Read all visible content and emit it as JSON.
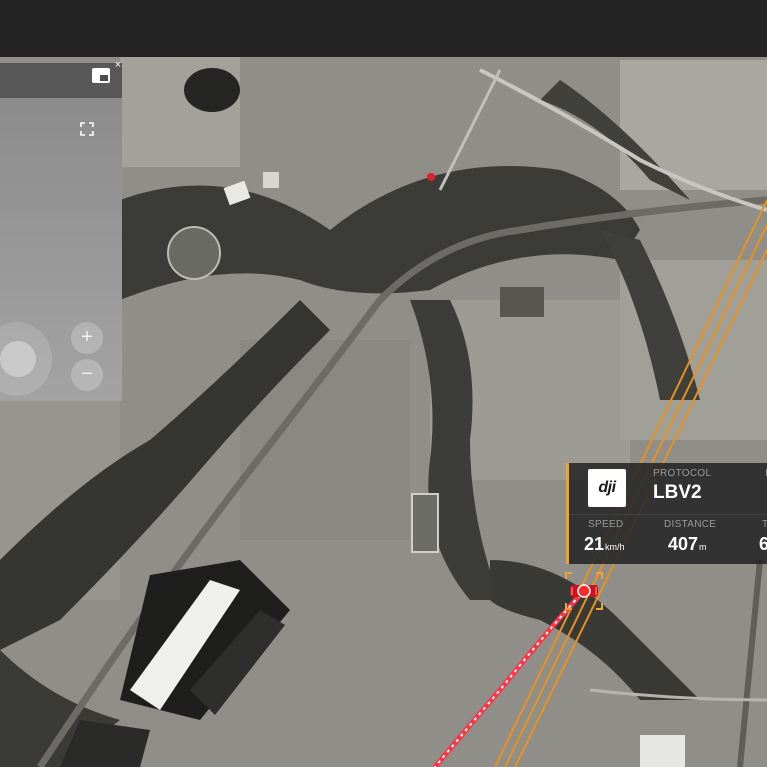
{
  "map": {
    "drone_marker_color": "#e0202a",
    "flight_path_color": "#ff3344",
    "power_line_color": "#e8921e",
    "map_style": "satellite-monochrome"
  },
  "pip_panel": {
    "zoom_in_label": "+",
    "zoom_out_label": "−",
    "close_label": "×"
  },
  "drone_card": {
    "logo_text": "dji",
    "protocol_label": "PROTOCOL",
    "protocol_value": "LBV2",
    "speed_label": "SPEED",
    "speed_value": "21",
    "speed_unit": "km/h",
    "distance_label": "DISTANCE",
    "distance_value": "407",
    "distance_unit": "m",
    "third_label_partial": "T",
    "third_value_partial": "6",
    "fourth_label_partial": "I",
    "accent_color": "#f2a233"
  }
}
